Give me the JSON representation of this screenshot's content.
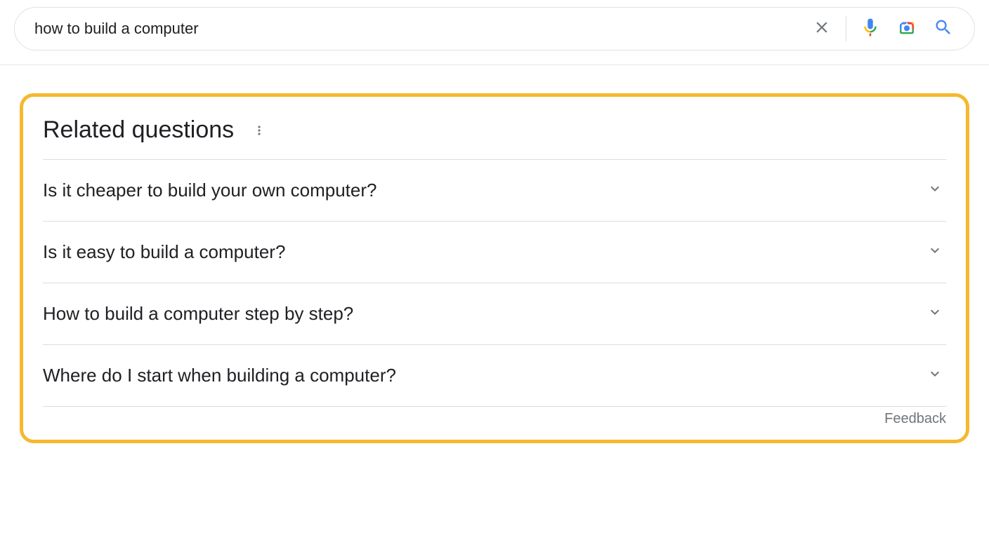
{
  "search": {
    "query": "how to build a computer"
  },
  "related": {
    "heading": "Related questions",
    "questions": [
      "Is it cheaper to build your own computer?",
      "Is it easy to build a computer?",
      "How to build a computer step by step?",
      "Where do I start when building a computer?"
    ],
    "feedback_label": "Feedback"
  }
}
